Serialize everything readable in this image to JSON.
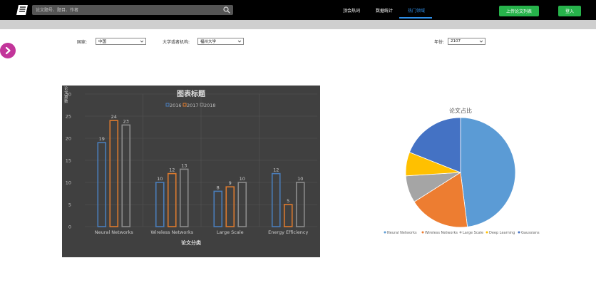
{
  "header": {
    "search_placeholder": "论文题号、题目、作者",
    "nav": [
      "顶会热词",
      "数据统计",
      "热门领域"
    ],
    "upload_label": "上传论文列表",
    "login_label": "登入"
  },
  "filters": {
    "country_label": "国家:",
    "country_value": "中国",
    "org_label": "大学或者机构:",
    "org_value": "福州大学",
    "year_label": "年份:",
    "year_value": "2107"
  },
  "colors": {
    "accent_blue": "#2f8fe8",
    "green": "#27b34b",
    "magenta": "#c2359a",
    "series_2016": "#4a7ebb",
    "series_2017": "#dd7a2e",
    "series_2018": "#8c8c8c"
  },
  "icons": [
    "book-logo-icon",
    "search-icon",
    "chevron-right-icon",
    "chevron-down-icon"
  ],
  "chart_data": [
    {
      "type": "bar",
      "title": "图表标题",
      "xlabel": "论文分类",
      "ylabel": "论文篇数",
      "categories": [
        "Neural Networks",
        "Wireless Networks",
        "Large Scale",
        "Energy Efficiency"
      ],
      "series": [
        {
          "name": "2016",
          "values": [
            19,
            10,
            8,
            12
          ]
        },
        {
          "name": "2017",
          "values": [
            24,
            12,
            9,
            5
          ]
        },
        {
          "name": "2018",
          "values": [
            23,
            13,
            10,
            10
          ]
        }
      ],
      "ylim": [
        0,
        30
      ],
      "yticks": [
        0,
        5,
        10,
        15,
        20,
        25,
        30
      ],
      "grid": true,
      "legend": "top"
    },
    {
      "type": "pie",
      "title": "论文占比",
      "labels": [
        "Neural Networks",
        "Wireless Networks",
        "Large Scale",
        "Deep Learning",
        "Gaussians"
      ],
      "values": [
        48,
        18,
        8,
        7,
        19
      ],
      "colors": [
        "#5b9bd5",
        "#ed7d31",
        "#a5a5a5",
        "#ffc000",
        "#4472c4"
      ],
      "legend": "bottom"
    }
  ]
}
